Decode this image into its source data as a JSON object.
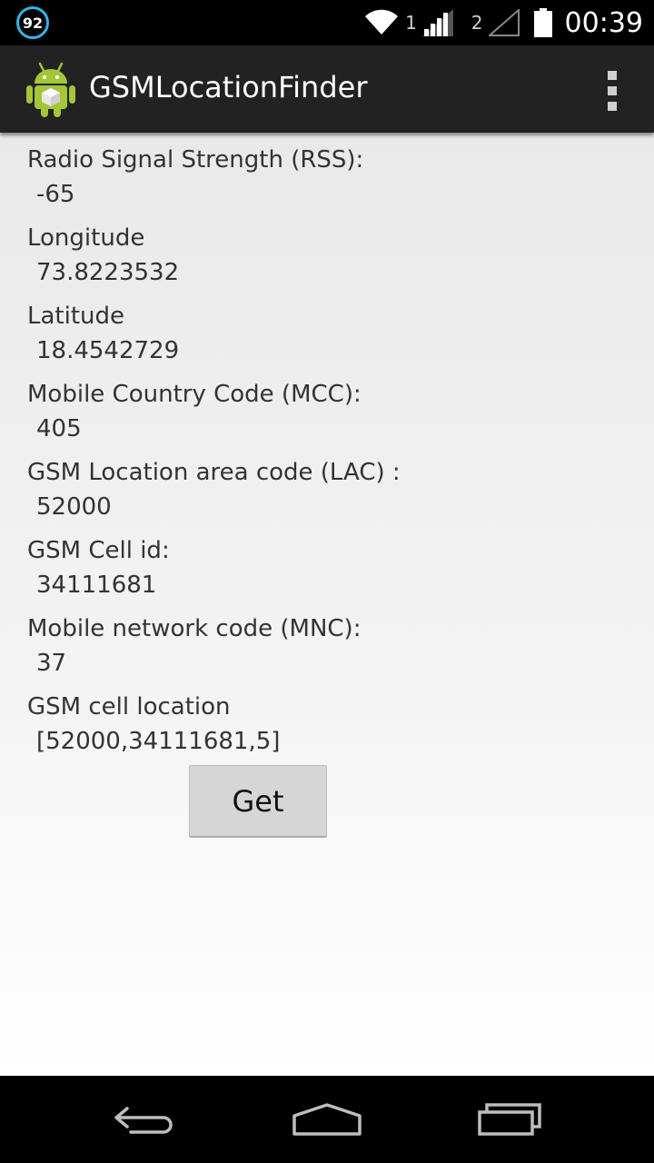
{
  "status_bar": {
    "notification_count": "92",
    "sim1_label": "1",
    "sim2_label": "2",
    "clock": "00:39",
    "icons": [
      "wifi-icon",
      "signal-icon",
      "battery-icon"
    ]
  },
  "action_bar": {
    "title": "GSMLocationFinder",
    "app_icon": "android-icon",
    "overflow_icon": "overflow-menu-icon"
  },
  "fields": [
    {
      "label": "Radio Signal Strength (RSS):",
      "value": "-65"
    },
    {
      "label": "Longitude",
      "value": "73.8223532"
    },
    {
      "label": "Latitude",
      "value": "18.4542729"
    },
    {
      "label": "Mobile Country Code (MCC):",
      "value": "405"
    },
    {
      "label": "GSM Location area code (LAC) :",
      "value": "52000"
    },
    {
      "label": "GSM Cell id:",
      "value": "34111681"
    },
    {
      "label": "Mobile network code (MNC):",
      "value": "37"
    },
    {
      "label": "GSM cell location",
      "value": "[52000,34111681,5]"
    }
  ],
  "get_button_label": "Get",
  "nav_bar": {
    "icons": [
      "back-icon",
      "home-icon",
      "recent-apps-icon"
    ]
  }
}
